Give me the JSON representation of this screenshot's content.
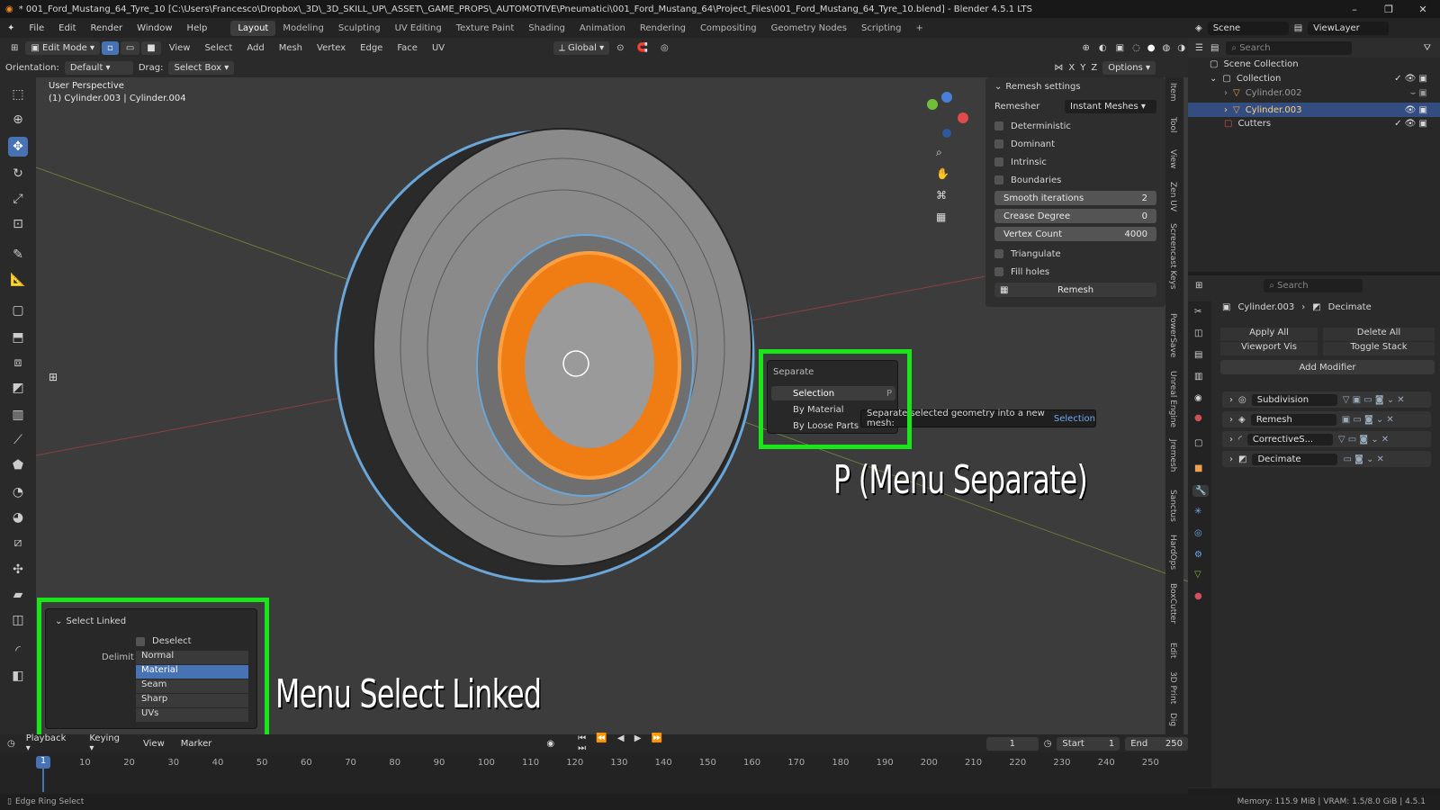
{
  "title": {
    "text": "* 001_Ford_Mustang_64_Tyre_10 [C:\\Users\\Francesco\\Dropbox\\_3D\\_3D_SKILL_UP\\_ASSET\\_GAME_PROPS\\_AUTOMOTIVE\\Pneumatici\\001_Ford_Mustang_64\\Project_Files\\001_Ford_Mustang_64_Tyre_10.blend] - Blender 4.5.1 LTS",
    "min": "–",
    "max": "❐",
    "close": "✕"
  },
  "menu": [
    "File",
    "Edit",
    "Render",
    "Window",
    "Help"
  ],
  "workspaces": [
    "Layout",
    "Modeling",
    "Sculpting",
    "UV Editing",
    "Texture Paint",
    "Shading",
    "Animation",
    "Rendering",
    "Compositing",
    "Geometry Nodes",
    "Scripting",
    "+"
  ],
  "topright": {
    "scene": "Scene",
    "viewlayer": "ViewLayer"
  },
  "header": {
    "mode": "Edit Mode",
    "menus": [
      "View",
      "Select",
      "Add",
      "Mesh",
      "Vertex",
      "Edge",
      "Face",
      "UV"
    ],
    "transform": "Global",
    "options": "Options"
  },
  "header2": {
    "orientation_label": "Orientation:",
    "orientation": "Default",
    "drag_label": "Drag:",
    "drag": "Select Box",
    "axes": [
      "X",
      "Y",
      "Z"
    ]
  },
  "viewport": {
    "perspective": "User Perspective",
    "objects": "(1) Cylinder.003 | Cylinder.004"
  },
  "remesh": {
    "title": "Remesh settings",
    "remesher_label": "Remesher",
    "remesher": "Instant Meshes",
    "checks": [
      "Deterministic",
      "Dominant",
      "Intrinsic",
      "Boundaries"
    ],
    "fields": [
      {
        "label": "Smooth iterations",
        "value": "2"
      },
      {
        "label": "Crease Degree",
        "value": "0"
      },
      {
        "label": "Vertex Count",
        "value": "4000"
      }
    ],
    "checks2": [
      "Triangulate",
      "Fill holes"
    ],
    "button": "Remesh"
  },
  "sidetabs": [
    "Item",
    "Tool",
    "View",
    "Zen UV",
    "Screencast Keys",
    "PowerSave",
    "Unreal Engine",
    "Jremesh",
    "Sanctus",
    "HardOps",
    "BoxCutter",
    "Edit",
    "3D Print",
    "Dig"
  ],
  "separate": {
    "title": "Separate",
    "items": [
      {
        "label": "Selection",
        "key": "P"
      },
      {
        "label": "By Material",
        "key": ""
      },
      {
        "label": "By Loose Parts",
        "key": ""
      }
    ],
    "tooltip_text": "Separate selected geometry into a new mesh:",
    "tooltip_val": "Selection"
  },
  "annotations": {
    "separate": "P (Menu Separate)",
    "select_linked": "Menu Select Linked"
  },
  "select_linked": {
    "title": "Select Linked",
    "deselect": "Deselect",
    "delimit_label": "Delimit",
    "options": [
      "Normal",
      "Material",
      "Seam",
      "Sharp",
      "UVs"
    ],
    "selected": "Material"
  },
  "outliner": {
    "search": "Search",
    "root": "Scene Collection",
    "collection": "Collection",
    "items": [
      "Cylinder.002",
      "Cylinder.003",
      "Cutters"
    ]
  },
  "props": {
    "search": "Search",
    "object": "Cylinder.003",
    "modifier": "Decimate",
    "apply_all": "Apply All",
    "delete_all": "Delete All",
    "viewport_vis": "Viewport Vis",
    "toggle_stack": "Toggle Stack",
    "add_modifier": "Add Modifier",
    "modifiers": [
      "Subdivision",
      "Remesh",
      "CorrectiveS...",
      "Decimate"
    ]
  },
  "timeline": {
    "menus": [
      "Playback",
      "Keying",
      "View",
      "Marker"
    ],
    "frame": "1",
    "start_label": "Start",
    "start": "1",
    "end_label": "End",
    "end": "250",
    "ticks": [
      "10",
      "20",
      "30",
      "40",
      "50",
      "60",
      "70",
      "80",
      "90",
      "100",
      "110",
      "120",
      "130",
      "140",
      "150",
      "160",
      "170",
      "180",
      "190",
      "200",
      "210",
      "220",
      "230",
      "240",
      "250"
    ],
    "current": "1"
  },
  "status": {
    "left": "Edge Ring Select",
    "right": "Memory: 115.9 MiB | VRAM: 1.5/8.0 GiB | 4.5.1"
  }
}
